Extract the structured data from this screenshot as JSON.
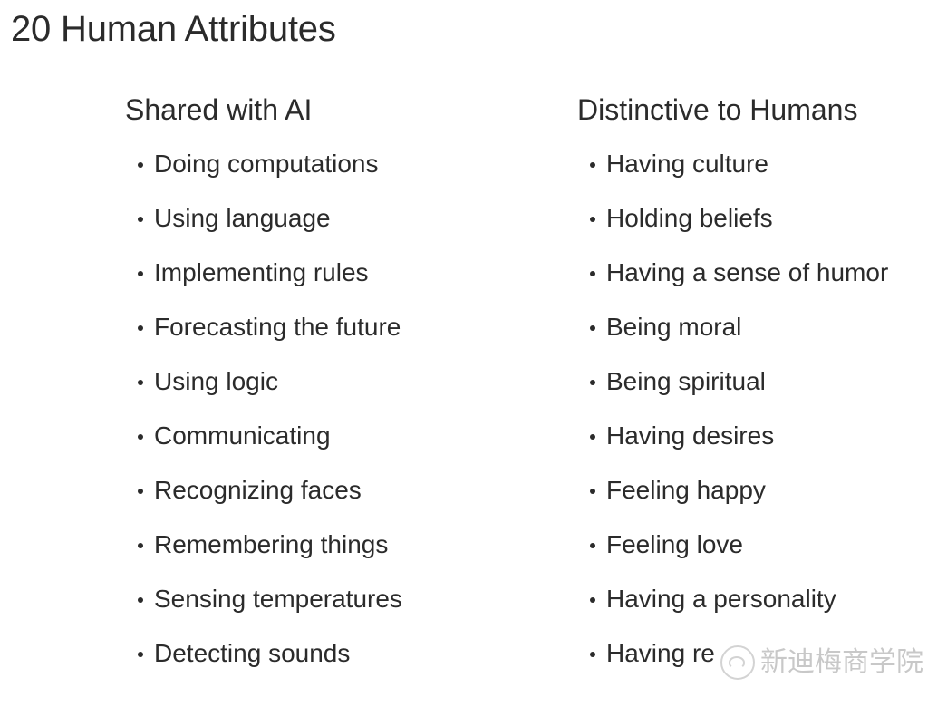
{
  "slide": {
    "title": "20 Human Attributes",
    "background_color": "#ffffff",
    "text_color": "#2b2b2b"
  },
  "columns": [
    {
      "heading": "Shared with AI",
      "items": [
        "Doing computations",
        "Using language",
        "Implementing rules",
        "Forecasting the future",
        "Using logic",
        "Communicating",
        "Recognizing faces",
        "Remembering things",
        "Sensing temperatures",
        "Detecting sounds"
      ]
    },
    {
      "heading": "Distinctive to Humans",
      "items": [
        "Having culture",
        "Holding beliefs",
        "Having a sense of humor",
        "Being moral",
        "Being spiritual",
        "Having desires",
        "Feeling happy",
        "Feeling love",
        "Having a personality",
        "Having re"
      ]
    }
  ],
  "watermark": {
    "text": "新迪梅商学院",
    "logo_icon": "wechat-logo-icon",
    "color": "#a8a8a8"
  }
}
